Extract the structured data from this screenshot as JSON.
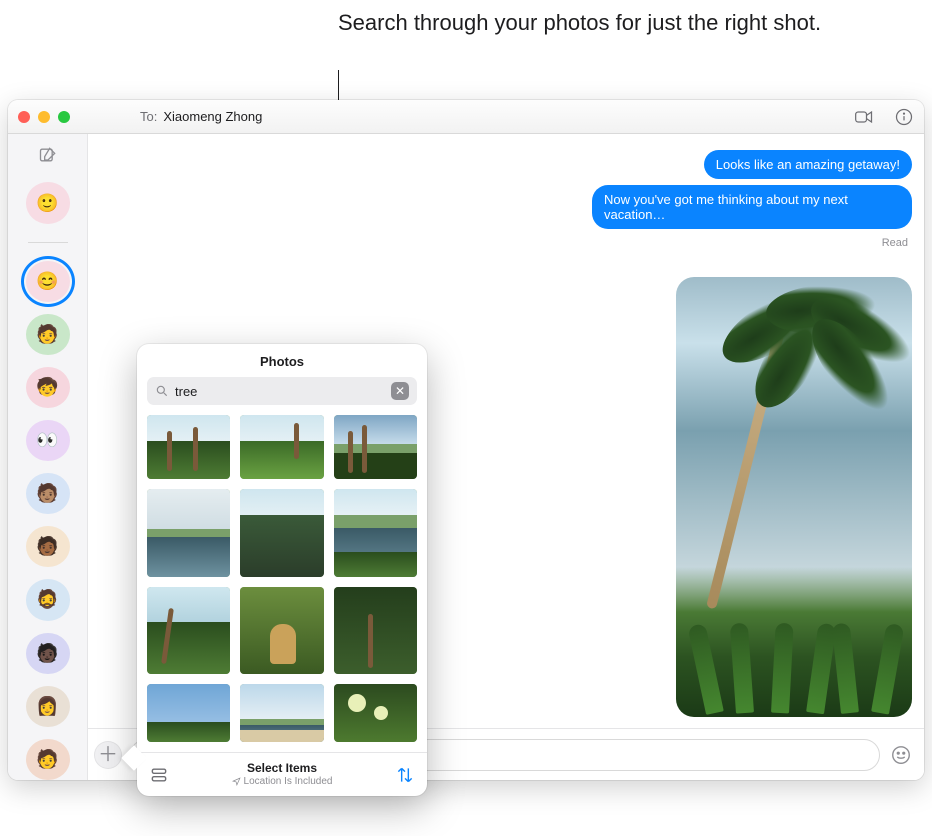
{
  "annotation": "Search through your photos for just the right shot.",
  "titlebar": {
    "to_label": "To:",
    "recipient": "Xiaomeng Zhong"
  },
  "sidebar": {
    "items": [
      {
        "name": "pinned-1",
        "bg": "#f7dce4"
      },
      {
        "name": "contact-1",
        "bg": "#f7dce4",
        "selected": true
      },
      {
        "name": "contact-2",
        "bg": "#c9e7c9"
      },
      {
        "name": "contact-3",
        "bg": "#f6d6de"
      },
      {
        "name": "contact-4",
        "bg": "#ead6f6"
      },
      {
        "name": "contact-5",
        "bg": "#d6e4f6"
      },
      {
        "name": "contact-6",
        "bg": "#f5e5d0"
      },
      {
        "name": "contact-7",
        "bg": "#d6e6f4"
      },
      {
        "name": "contact-8",
        "bg": "#d6d6f4"
      },
      {
        "name": "contact-9",
        "bg": "#e9e0d5"
      },
      {
        "name": "contact-10",
        "bg": "#f2d9cc"
      }
    ]
  },
  "thread": {
    "bubbles": [
      "Looks like an amazing getaway!",
      "Now you've got me thinking about my next vacation…"
    ],
    "status": "Read"
  },
  "compose": {
    "placeholder": ""
  },
  "popover": {
    "title": "Photos",
    "search_value": "tree",
    "footer_title": "Select Items",
    "footer_sub": "Location Is Included"
  }
}
